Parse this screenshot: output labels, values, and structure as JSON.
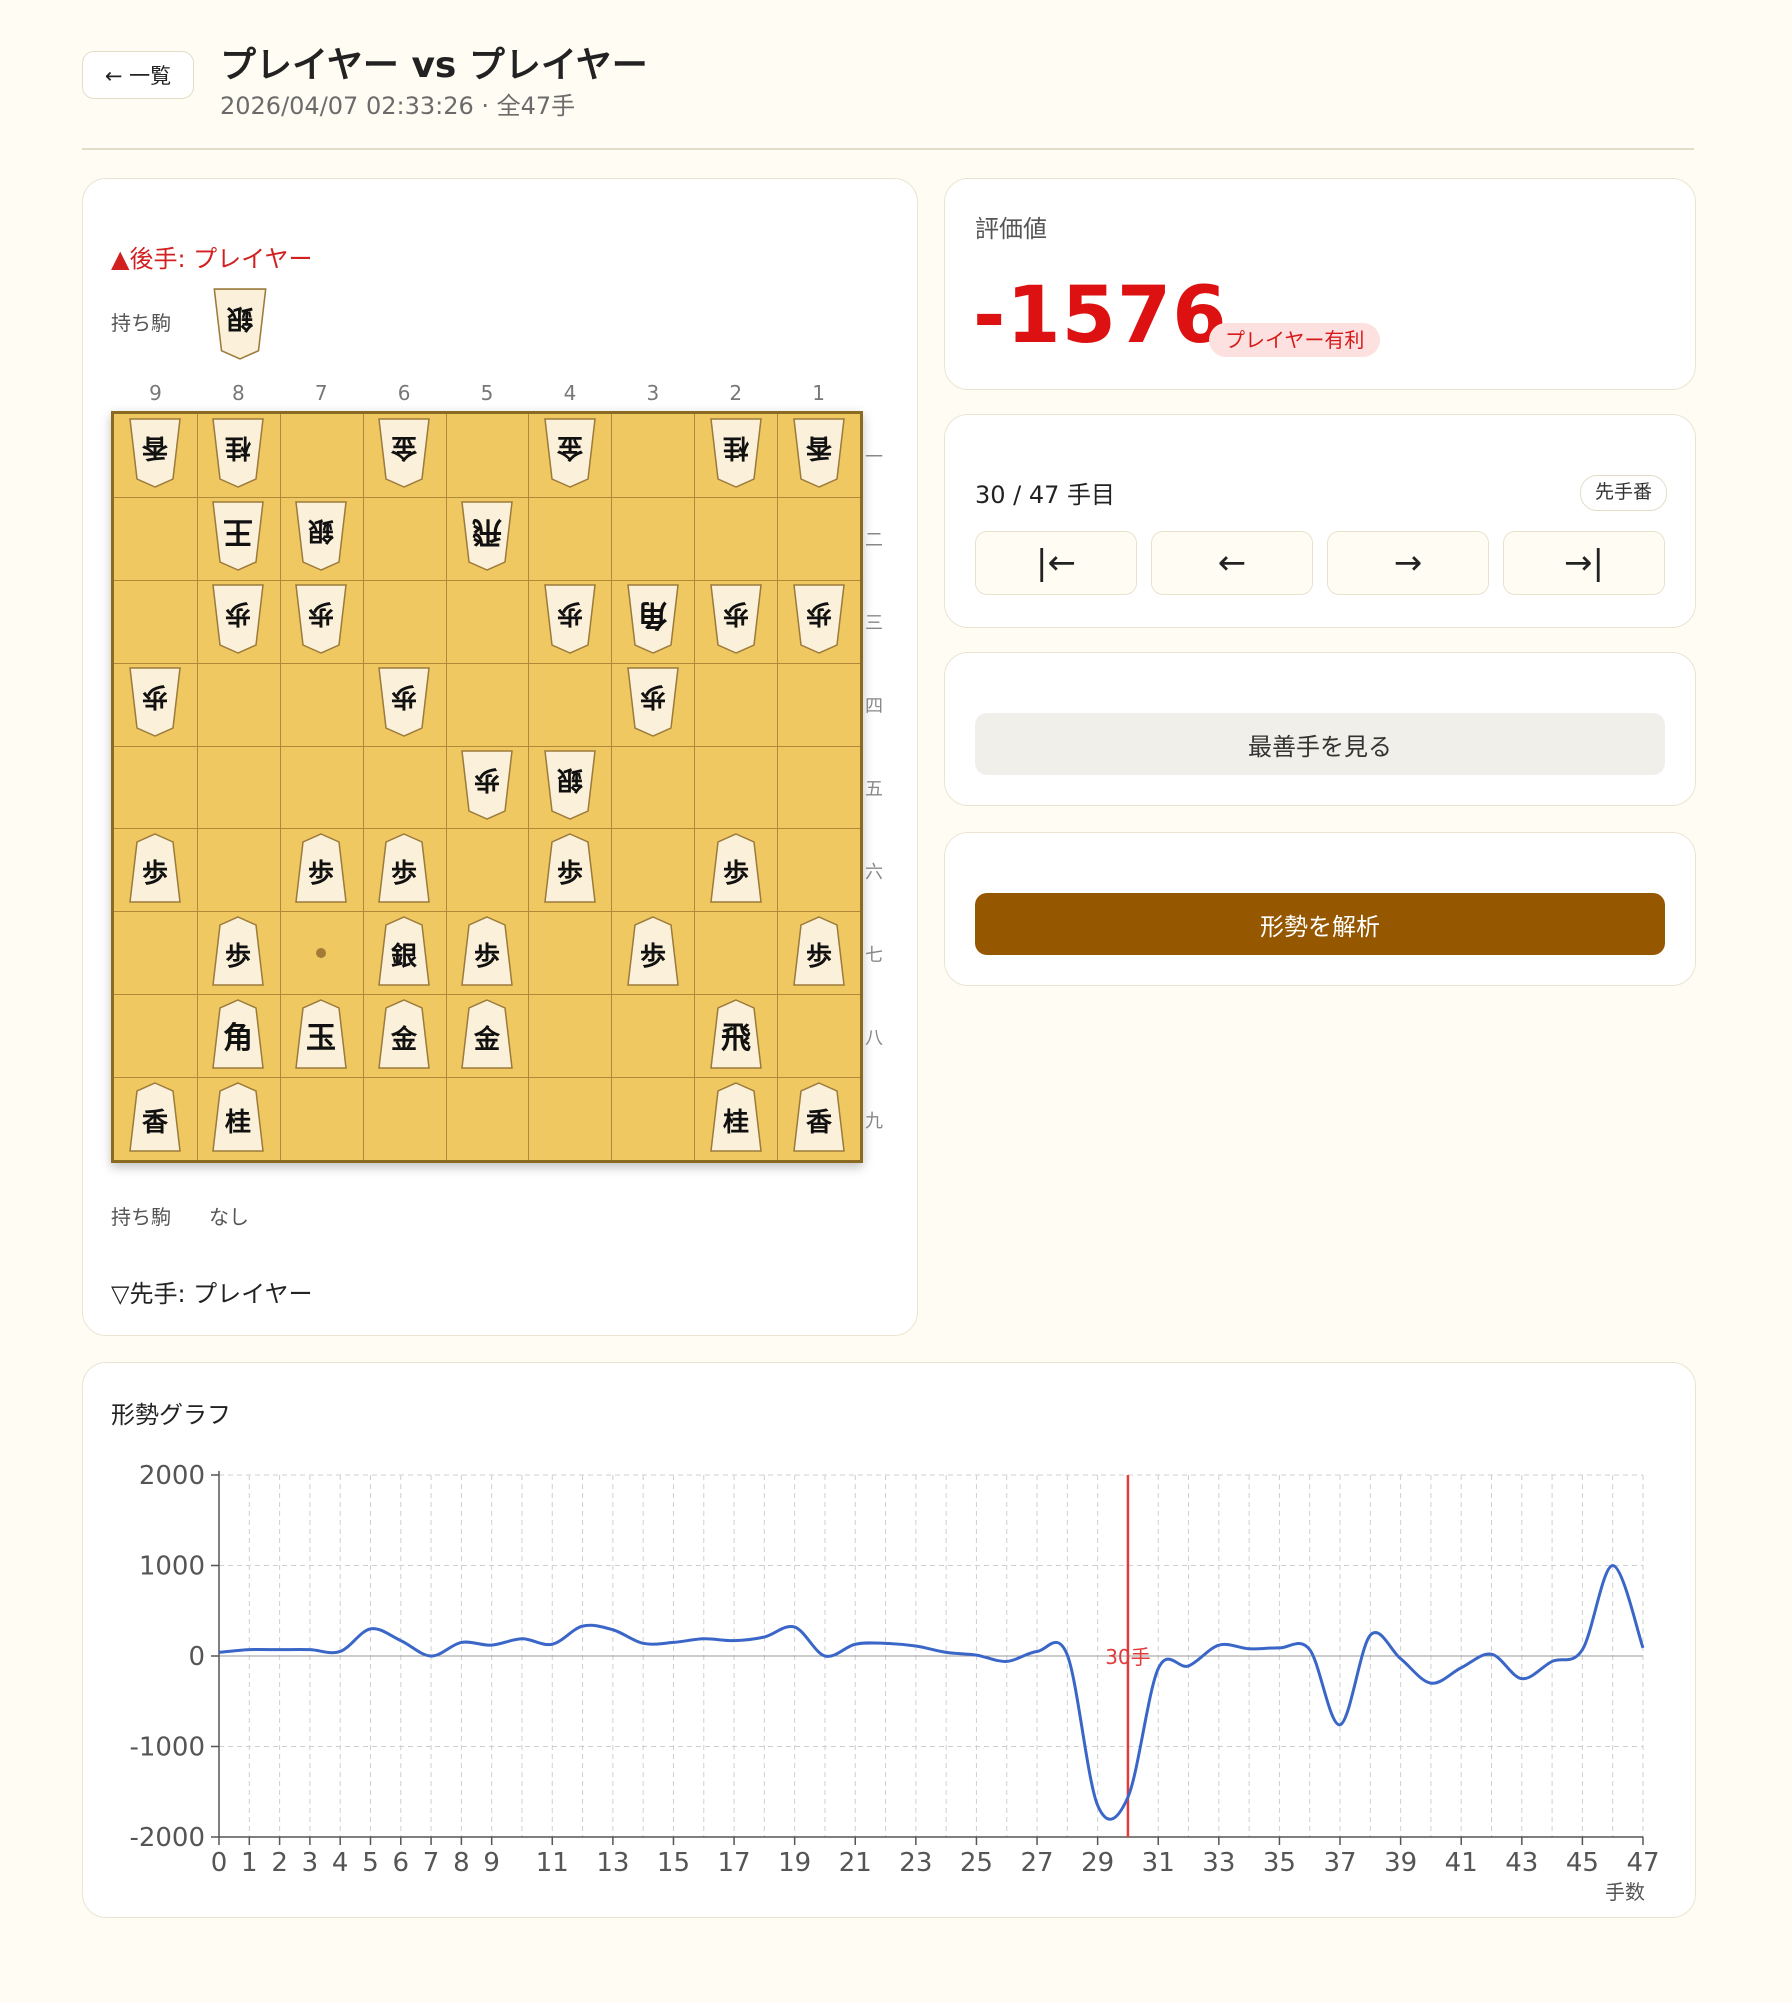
{
  "header": {
    "back_label": "← 一覧",
    "title": "プレイヤー vs プレイヤー",
    "subtitle": "2026/04/07 02:33:26 · 全47手"
  },
  "board": {
    "gote_label": "▲後手: プレイヤー",
    "gote_hand_label": "持ち駒",
    "gote_hand": [
      "銀"
    ],
    "sente_hand_label": "持ち駒",
    "sente_hand_none": "なし",
    "sente_label": "▽先手: プレイヤー",
    "files": [
      "9",
      "8",
      "7",
      "6",
      "5",
      "4",
      "3",
      "2",
      "1"
    ],
    "ranks": [
      "一",
      "二",
      "三",
      "四",
      "五",
      "六",
      "七",
      "八",
      "九"
    ],
    "pieces": [
      {
        "f": 9,
        "r": 1,
        "k": "香",
        "o": "gote"
      },
      {
        "f": 8,
        "r": 1,
        "k": "桂",
        "o": "gote"
      },
      {
        "f": 6,
        "r": 1,
        "k": "金",
        "o": "gote"
      },
      {
        "f": 4,
        "r": 1,
        "k": "金",
        "o": "gote"
      },
      {
        "f": 2,
        "r": 1,
        "k": "桂",
        "o": "gote"
      },
      {
        "f": 1,
        "r": 1,
        "k": "香",
        "o": "gote"
      },
      {
        "f": 8,
        "r": 2,
        "k": "王",
        "o": "gote"
      },
      {
        "f": 7,
        "r": 2,
        "k": "銀",
        "o": "gote"
      },
      {
        "f": 5,
        "r": 2,
        "k": "飛",
        "o": "gote"
      },
      {
        "f": 8,
        "r": 3,
        "k": "歩",
        "o": "gote"
      },
      {
        "f": 7,
        "r": 3,
        "k": "歩",
        "o": "gote"
      },
      {
        "f": 4,
        "r": 3,
        "k": "歩",
        "o": "gote"
      },
      {
        "f": 3,
        "r": 3,
        "k": "角",
        "o": "gote"
      },
      {
        "f": 2,
        "r": 3,
        "k": "歩",
        "o": "gote"
      },
      {
        "f": 1,
        "r": 3,
        "k": "歩",
        "o": "gote"
      },
      {
        "f": 9,
        "r": 4,
        "k": "歩",
        "o": "gote"
      },
      {
        "f": 6,
        "r": 4,
        "k": "歩",
        "o": "gote"
      },
      {
        "f": 3,
        "r": 4,
        "k": "歩",
        "o": "gote"
      },
      {
        "f": 5,
        "r": 5,
        "k": "歩",
        "o": "gote"
      },
      {
        "f": 4,
        "r": 5,
        "k": "銀",
        "o": "gote"
      },
      {
        "f": 9,
        "r": 6,
        "k": "歩",
        "o": "sente"
      },
      {
        "f": 7,
        "r": 6,
        "k": "歩",
        "o": "sente"
      },
      {
        "f": 6,
        "r": 6,
        "k": "歩",
        "o": "sente"
      },
      {
        "f": 4,
        "r": 6,
        "k": "歩",
        "o": "sente"
      },
      {
        "f": 2,
        "r": 6,
        "k": "歩",
        "o": "sente"
      },
      {
        "f": 8,
        "r": 7,
        "k": "歩",
        "o": "sente"
      },
      {
        "f": 6,
        "r": 7,
        "k": "銀",
        "o": "sente"
      },
      {
        "f": 5,
        "r": 7,
        "k": "歩",
        "o": "sente"
      },
      {
        "f": 3,
        "r": 7,
        "k": "歩",
        "o": "sente"
      },
      {
        "f": 1,
        "r": 7,
        "k": "歩",
        "o": "sente"
      },
      {
        "f": 8,
        "r": 8,
        "k": "角",
        "o": "sente"
      },
      {
        "f": 7,
        "r": 8,
        "k": "玉",
        "o": "sente"
      },
      {
        "f": 6,
        "r": 8,
        "k": "金",
        "o": "sente"
      },
      {
        "f": 5,
        "r": 8,
        "k": "金",
        "o": "sente"
      },
      {
        "f": 2,
        "r": 8,
        "k": "飛",
        "o": "sente"
      },
      {
        "f": 9,
        "r": 9,
        "k": "香",
        "o": "sente"
      },
      {
        "f": 8,
        "r": 9,
        "k": "桂",
        "o": "sente"
      },
      {
        "f": 2,
        "r": 9,
        "k": "桂",
        "o": "sente"
      },
      {
        "f": 1,
        "r": 9,
        "k": "香",
        "o": "sente"
      }
    ],
    "last_move_marker": {
      "f": 7,
      "r": 7
    }
  },
  "eval": {
    "label": "評価値",
    "value": "-1576",
    "badge": "プレイヤー有利"
  },
  "moves": {
    "count_text": "30 / 47 手目",
    "turn_badge": "先手番",
    "nav": [
      "|←",
      "←",
      "→",
      "→|"
    ]
  },
  "best_move_label": "最善手を見る",
  "analyze_label": "形勢を解析",
  "graph": {
    "title": "形勢グラフ",
    "xlabel": "手数",
    "current_label": "30手",
    "colors": {
      "line": "#3a66c8",
      "marker": "#e33a3a"
    }
  },
  "chart_data": {
    "type": "line",
    "title": "形勢グラフ",
    "xlabel": "手数",
    "ylabel": "",
    "ylim": [
      -2000,
      2000
    ],
    "xlim": [
      0,
      47
    ],
    "yticks": [
      2000,
      1000,
      0,
      -1000,
      -2000
    ],
    "xticks": [
      0,
      1,
      2,
      3,
      4,
      5,
      6,
      7,
      8,
      9,
      11,
      13,
      15,
      17,
      19,
      21,
      23,
      25,
      27,
      29,
      31,
      33,
      35,
      37,
      39,
      41,
      43,
      45,
      47
    ],
    "grid": true,
    "current_move": 30,
    "x": [
      0,
      1,
      2,
      3,
      4,
      5,
      6,
      7,
      8,
      9,
      10,
      11,
      12,
      13,
      14,
      15,
      16,
      17,
      18,
      19,
      20,
      21,
      22,
      23,
      24,
      25,
      26,
      27,
      28,
      29,
      30,
      31,
      32,
      33,
      34,
      35,
      36,
      37,
      38,
      39,
      40,
      41,
      42,
      43,
      44,
      45,
      46,
      47
    ],
    "values": [
      40,
      70,
      70,
      70,
      50,
      300,
      170,
      0,
      150,
      120,
      190,
      130,
      330,
      290,
      140,
      150,
      190,
      170,
      210,
      320,
      0,
      130,
      140,
      110,
      40,
      10,
      -60,
      50,
      10,
      -1650,
      -1560,
      -140,
      -110,
      120,
      80,
      90,
      70,
      -760,
      230,
      -30,
      -300,
      -130,
      20,
      -250,
      -60,
      70,
      1000,
      90
    ]
  }
}
